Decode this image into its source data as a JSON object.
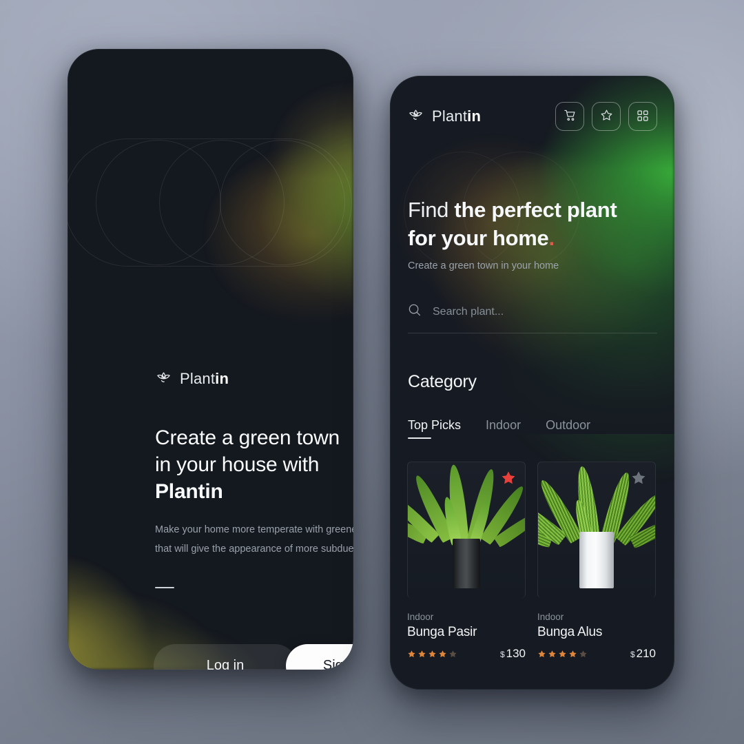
{
  "brand": {
    "name_light": "Plant",
    "name_bold": "in",
    "logo_icon": "lotus-leaf-icon"
  },
  "onboarding": {
    "headline_line1": "Create a green town",
    "headline_line2": "in your house with",
    "headline_brand": "Plantin",
    "body": "Make your home more temperate with greenery that will give the appearance of more subdued",
    "login_label": "Log in",
    "signin_label": "Sign In"
  },
  "home": {
    "header_icons": [
      {
        "name": "cart-icon",
        "label": "Cart"
      },
      {
        "name": "star-icon",
        "label": "Favorites"
      },
      {
        "name": "grid-icon",
        "label": "Categories"
      }
    ],
    "hero_title_part1": "Find",
    "hero_title_part2": " the perfect plant",
    "hero_title_part3": "for your home",
    "hero_title_dot": ".",
    "hero_subtitle": "Create a green town in your home",
    "search": {
      "placeholder": "Search plant...",
      "value": "",
      "icon": "search-icon"
    },
    "category_title": "Category",
    "tabs": [
      {
        "label": "Top Picks",
        "active": true
      },
      {
        "label": "Indoor",
        "active": false
      },
      {
        "label": "Outdoor",
        "active": false
      }
    ],
    "products": [
      {
        "category": "Indoor",
        "name": "Bunga Pasir",
        "rating": 4,
        "rating_max": 5,
        "currency": "$",
        "price": "130",
        "badge": "star-filled-icon",
        "badge_color": "#e8413c",
        "pot_color": "#2b2e31"
      },
      {
        "category": "Indoor",
        "name": "Bunga Alus",
        "rating": 4,
        "rating_max": 5,
        "currency": "$",
        "price": "210",
        "badge": "star-filled-icon",
        "badge_color": "#6d747b",
        "pot_color": "#eceef0"
      }
    ]
  },
  "colors": {
    "accent_green": "#3cbe3c",
    "accent_orange": "#e0863a",
    "accent_red": "#e05a4a",
    "surface_dark": "#161a22",
    "text_primary": "#f4f6f8",
    "text_muted": "#8c949d"
  }
}
